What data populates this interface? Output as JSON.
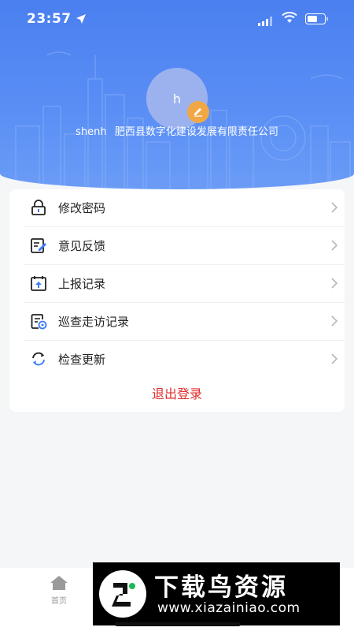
{
  "status_bar": {
    "time": "23:57"
  },
  "profile": {
    "avatar_initial": "h",
    "username": "shenh",
    "organization": "肥西县数字化建设发展有限责任公司"
  },
  "menu": [
    {
      "label": "修改密码",
      "icon": "lock-icon"
    },
    {
      "label": "意见反馈",
      "icon": "feedback-edit-icon"
    },
    {
      "label": "上报记录",
      "icon": "upload-calendar-icon"
    },
    {
      "label": "巡查走访记录",
      "icon": "patrol-doc-icon"
    },
    {
      "label": "检查更新",
      "icon": "refresh-icon"
    }
  ],
  "logout_label": "退出登录",
  "tabbar": {
    "home_label": "首页"
  },
  "watermark": {
    "title": "下载鸟资源",
    "url": "www.xiazainiao.com"
  },
  "colors": {
    "primary": "#4a7ff0",
    "accent_orange": "#f0a847",
    "danger": "#e02b2b"
  }
}
